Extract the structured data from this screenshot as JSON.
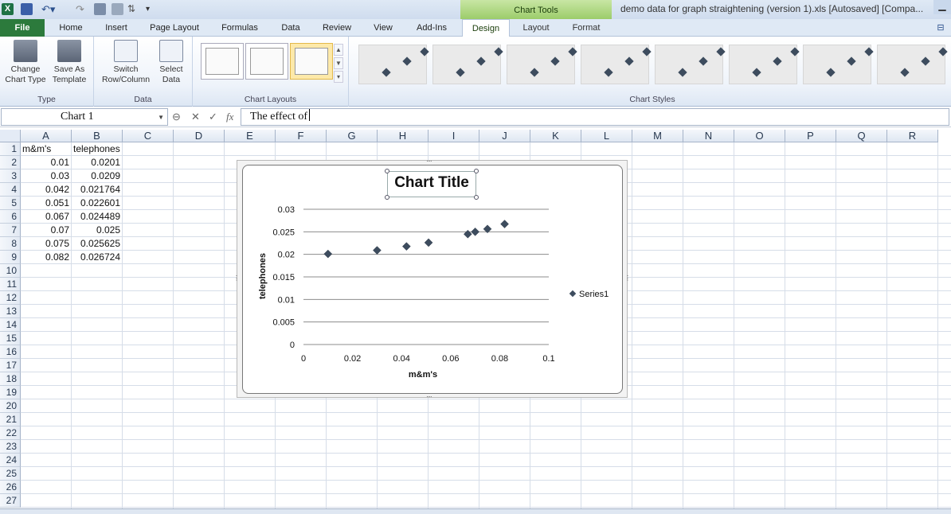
{
  "window": {
    "title": "demo data for graph straightening (version 1).xls [Autosaved]  [Compa...",
    "contextual_group": "Chart Tools",
    "excel_logo": "X"
  },
  "tabs": [
    "File",
    "Home",
    "Insert",
    "Page Layout",
    "Formulas",
    "Data",
    "Review",
    "View",
    "Add-Ins",
    "Design",
    "Layout",
    "Format"
  ],
  "ribbon": {
    "type_group": {
      "label": "Type",
      "change_chart_type": [
        "Change",
        "Chart Type"
      ],
      "save_as_template": [
        "Save As",
        "Template"
      ]
    },
    "data_group": {
      "label": "Data",
      "switch_row_column": [
        "Switch",
        "Row/Column"
      ],
      "select_data": [
        "Select",
        "Data"
      ]
    },
    "chart_layouts_label": "Chart Layouts",
    "chart_styles_label": "Chart Styles"
  },
  "formula_bar": {
    "name_box": "Chart 1",
    "fx": "fx",
    "content": "The effect of"
  },
  "columns": [
    "A",
    "B",
    "C",
    "D",
    "E",
    "F",
    "G",
    "H",
    "I",
    "J",
    "K",
    "L",
    "M",
    "N",
    "O",
    "P",
    "Q",
    "R"
  ],
  "rows": [
    "1",
    "2",
    "3",
    "4",
    "5",
    "6",
    "7",
    "8",
    "9",
    "10",
    "11",
    "12",
    "13",
    "14",
    "15",
    "16",
    "17",
    "18",
    "19",
    "20",
    "21",
    "22",
    "23",
    "24",
    "25",
    "26",
    "27"
  ],
  "cells": {
    "A1": "m&m's",
    "B1": "telephones",
    "A2": "0.01",
    "B2": "0.0201",
    "A3": "0.03",
    "B3": "0.0209",
    "A4": "0.042",
    "B4": "0.021764",
    "A5": "0.051",
    "B5": "0.022601",
    "A6": "0.067",
    "B6": "0.024489",
    "A7": "0.07",
    "B7": "0.025",
    "A8": "0.075",
    "B8": "0.025625",
    "A9": "0.082",
    "B9": "0.026724"
  },
  "chart_data": {
    "type": "scatter",
    "title": "Chart Title",
    "xlabel": "m&m's",
    "ylabel": "telephones",
    "xlim": [
      0,
      0.1
    ],
    "ylim": [
      0,
      0.03
    ],
    "x_ticks": [
      "0",
      "0.02",
      "0.04",
      "0.06",
      "0.08",
      "0.1"
    ],
    "y_ticks": [
      "0",
      "0.005",
      "0.01",
      "0.015",
      "0.02",
      "0.025",
      "0.03"
    ],
    "grid": "horizontal",
    "legend_position": "right",
    "series": [
      {
        "name": "Series1",
        "color": "#3d4c5e",
        "x": [
          0.01,
          0.03,
          0.042,
          0.051,
          0.067,
          0.07,
          0.075,
          0.082
        ],
        "y": [
          0.0201,
          0.0209,
          0.021764,
          0.022601,
          0.024489,
          0.025,
          0.025625,
          0.026724
        ]
      }
    ]
  }
}
